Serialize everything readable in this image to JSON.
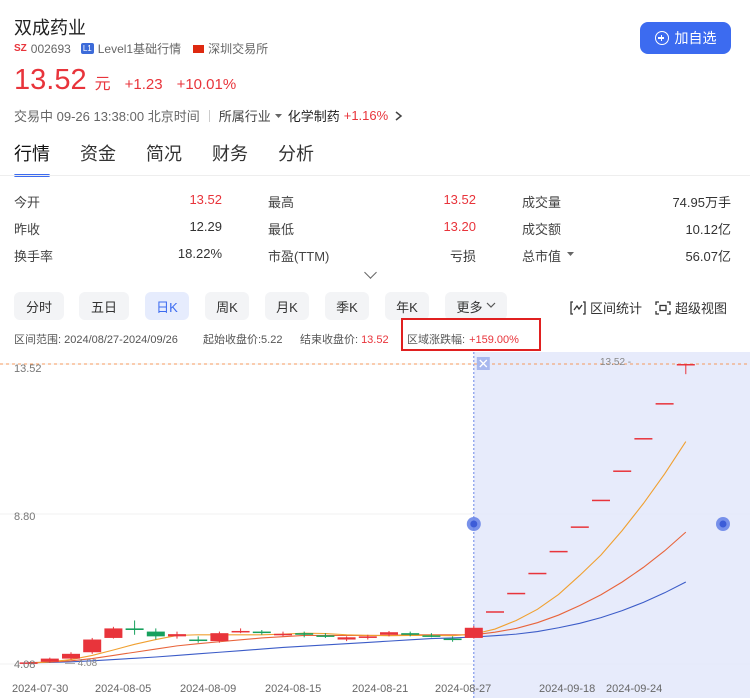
{
  "stock": {
    "name": "双成药业",
    "market_tag": "SZ",
    "code": "002693",
    "level_badge": "L1",
    "level_text": "Level1基础行情",
    "exchange": "深圳交易所",
    "price": "13.52",
    "unit": "元",
    "change": "+1.23",
    "change_pct": "+10.01%",
    "status_time": "交易中 09-26 13:38:00 北京时间",
    "industry_label": "所属行业",
    "industry_name": "化学制药",
    "industry_change": "+1.16%",
    "watch_label": "加自选"
  },
  "tabs": [
    "行情",
    "资金",
    "简况",
    "财务",
    "分析"
  ],
  "stats": [
    {
      "label": "今开",
      "value": "13.52",
      "color": "red"
    },
    {
      "label": "最高",
      "value": "13.52",
      "color": "red"
    },
    {
      "label": "成交量",
      "value": "74.95万手",
      "color": "dark"
    },
    {
      "label": "昨收",
      "value": "12.29",
      "color": "dark"
    },
    {
      "label": "最低",
      "value": "13.20",
      "color": "red"
    },
    {
      "label": "成交额",
      "value": "10.12亿",
      "color": "dark"
    },
    {
      "label": "换手率",
      "value": "18.22%",
      "color": "dark"
    },
    {
      "label": "市盈(TTM)",
      "value": "亏损",
      "color": "dark"
    },
    {
      "label": "总市值",
      "value": "56.07亿",
      "color": "dark"
    }
  ],
  "periods": [
    "分时",
    "五日",
    "日K",
    "周K",
    "月K",
    "季K",
    "年K",
    "更多"
  ],
  "active_period": "日K",
  "tools": {
    "range_stats": "区间统计",
    "super_view": "超级视图"
  },
  "range": {
    "range_text": "区间范围: 2024/08/27-2024/09/26",
    "start_close": "起始收盘价:5.22",
    "end_close_label": "结束收盘价:",
    "end_close_value": "13.52",
    "change_label": "区域涨跌幅:",
    "change_value": "+159.00%"
  },
  "colors": {
    "up": "#e8343b",
    "down": "#17a05d",
    "accent": "#3c6bf0",
    "ma5": "#f0a030",
    "ma10": "#e8643b",
    "ma20": "#3c5cc8"
  },
  "chart_data": {
    "type": "candlestick",
    "y_axis_labels": [
      "13.52",
      "8.80",
      "4.08"
    ],
    "x_axis_labels": [
      "2024-07-30",
      "2024-08-05",
      "2024-08-09",
      "2024-08-15",
      "2024-08-21",
      "2024-08-27",
      "2024-09-18",
      "2024-09-24"
    ],
    "ylim": [
      4.08,
      13.52
    ],
    "last_price_label": "13.52",
    "low_label": "4.08",
    "candles": [
      {
        "o": 4.1,
        "c": 4.13,
        "h": 4.15,
        "l": 4.06
      },
      {
        "o": 4.15,
        "c": 4.25,
        "h": 4.28,
        "l": 4.12
      },
      {
        "o": 4.25,
        "c": 4.4,
        "h": 4.45,
        "l": 4.22
      },
      {
        "o": 4.45,
        "c": 4.85,
        "h": 4.9,
        "l": 4.4
      },
      {
        "o": 4.9,
        "c": 5.2,
        "h": 5.25,
        "l": 4.88
      },
      {
        "o": 5.2,
        "c": 5.15,
        "h": 5.45,
        "l": 5.0
      },
      {
        "o": 5.1,
        "c": 4.95,
        "h": 5.2,
        "l": 4.85
      },
      {
        "o": 4.95,
        "c": 5.02,
        "h": 5.1,
        "l": 4.88
      },
      {
        "o": 4.85,
        "c": 4.82,
        "h": 4.95,
        "l": 4.75
      },
      {
        "o": 4.8,
        "c": 5.05,
        "h": 5.1,
        "l": 4.75
      },
      {
        "o": 5.1,
        "c": 5.12,
        "h": 5.2,
        "l": 5.05
      },
      {
        "o": 5.1,
        "c": 5.07,
        "h": 5.15,
        "l": 5.0
      },
      {
        "o": 5.0,
        "c": 5.03,
        "h": 5.1,
        "l": 4.95
      },
      {
        "o": 5.05,
        "c": 5.0,
        "h": 5.1,
        "l": 4.92
      },
      {
        "o": 4.98,
        "c": 4.96,
        "h": 5.05,
        "l": 4.9
      },
      {
        "o": 4.85,
        "c": 4.92,
        "h": 4.95,
        "l": 4.8
      },
      {
        "o": 4.9,
        "c": 4.95,
        "h": 5.0,
        "l": 4.85
      },
      {
        "o": 5.0,
        "c": 5.08,
        "h": 5.12,
        "l": 4.95
      },
      {
        "o": 5.05,
        "c": 5.0,
        "h": 5.1,
        "l": 4.95
      },
      {
        "o": 4.98,
        "c": 4.96,
        "h": 5.05,
        "l": 4.92
      },
      {
        "o": 4.88,
        "c": 4.86,
        "h": 4.95,
        "l": 4.78
      },
      {
        "o": 4.9,
        "c": 5.22,
        "h": 5.28,
        "l": 4.88
      },
      {
        "o": 5.74,
        "c": 5.74,
        "h": 5.74,
        "l": 5.74
      },
      {
        "o": 6.32,
        "c": 6.32,
        "h": 6.32,
        "l": 6.32
      },
      {
        "o": 6.95,
        "c": 6.95,
        "h": 6.95,
        "l": 6.95
      },
      {
        "o": 7.64,
        "c": 7.64,
        "h": 7.64,
        "l": 7.64
      },
      {
        "o": 8.41,
        "c": 8.41,
        "h": 8.41,
        "l": 8.41
      },
      {
        "o": 9.25,
        "c": 9.25,
        "h": 9.25,
        "l": 9.25
      },
      {
        "o": 10.17,
        "c": 10.17,
        "h": 10.17,
        "l": 10.17
      },
      {
        "o": 11.19,
        "c": 11.19,
        "h": 11.19,
        "l": 11.19
      },
      {
        "o": 12.29,
        "c": 12.29,
        "h": 12.29,
        "l": 12.29
      },
      {
        "o": 13.52,
        "c": 13.52,
        "h": 13.52,
        "l": 13.2
      }
    ],
    "ma5": [
      4.1,
      4.15,
      4.22,
      4.35,
      4.52,
      4.7,
      4.85,
      4.98,
      5.0,
      5.0,
      5.0,
      5.0,
      5.02,
      5.05,
      5.04,
      5.0,
      4.98,
      4.97,
      4.98,
      4.98,
      4.97,
      5.02,
      5.18,
      5.45,
      5.8,
      6.27,
      6.87,
      7.51,
      8.28,
      9.13,
      10.06,
      11.08
    ],
    "ma10": [
      4.12,
      4.14,
      4.18,
      4.25,
      4.35,
      4.45,
      4.55,
      4.65,
      4.72,
      4.78,
      4.84,
      4.9,
      4.94,
      4.98,
      4.98,
      4.98,
      4.98,
      4.98,
      5.0,
      5.0,
      5.0,
      5.0,
      5.08,
      5.2,
      5.38,
      5.62,
      5.92,
      6.26,
      6.66,
      7.12,
      7.64,
      8.23
    ],
    "ma20": [
      4.12,
      4.13,
      4.15,
      4.18,
      4.22,
      4.26,
      4.3,
      4.35,
      4.4,
      4.45,
      4.5,
      4.55,
      4.6,
      4.64,
      4.68,
      4.72,
      4.76,
      4.8,
      4.84,
      4.88,
      4.9,
      4.93,
      4.97,
      5.02,
      5.1,
      5.22,
      5.36,
      5.54,
      5.76,
      6.02,
      6.32,
      6.66
    ],
    "selection_start_index": 21
  }
}
